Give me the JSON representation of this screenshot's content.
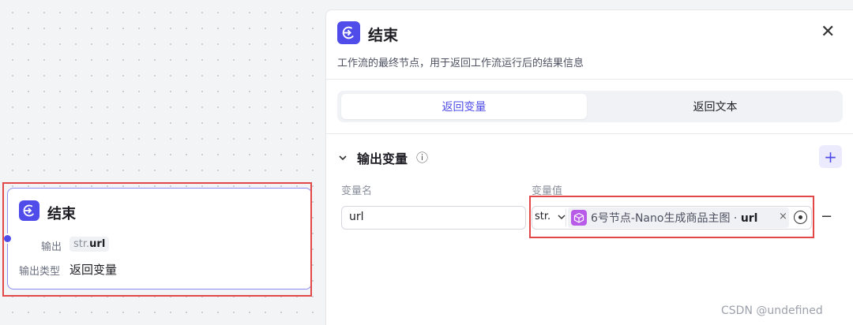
{
  "node": {
    "title": "结束",
    "output_label": "输出",
    "output_type_prefix": "str.",
    "output_value": "url",
    "output_type_label": "输出类型",
    "output_type_value": "返回变量"
  },
  "panel": {
    "title": "结束",
    "description": "工作流的最终节点，用于返回工作流运行后的结果信息",
    "close_glyph": "✕",
    "tabs": [
      {
        "label": "返回变量",
        "active": true
      },
      {
        "label": "返回文本",
        "active": false
      }
    ],
    "section_title": "输出变量",
    "info_glyph": "ⓘ",
    "add_glyph": "+",
    "col_name": "变量名",
    "col_value": "变量值",
    "row": {
      "name": "url",
      "type": "str.",
      "ref_prefix": "6号节点-Nano生成商品主图 · ",
      "ref_field": "url",
      "clear_glyph": "×",
      "remove_glyph": "−"
    }
  },
  "watermark": "CSDN @undefined",
  "colors": {
    "accent": "#4f4ce9",
    "highlight": "#e34848",
    "node_icon": "#b75be8"
  },
  "icons": [
    "end-node-icon",
    "close-icon",
    "chevron-down-icon",
    "info-icon",
    "plus-icon",
    "cube-icon",
    "clear-icon",
    "target-icon",
    "minus-icon"
  ]
}
